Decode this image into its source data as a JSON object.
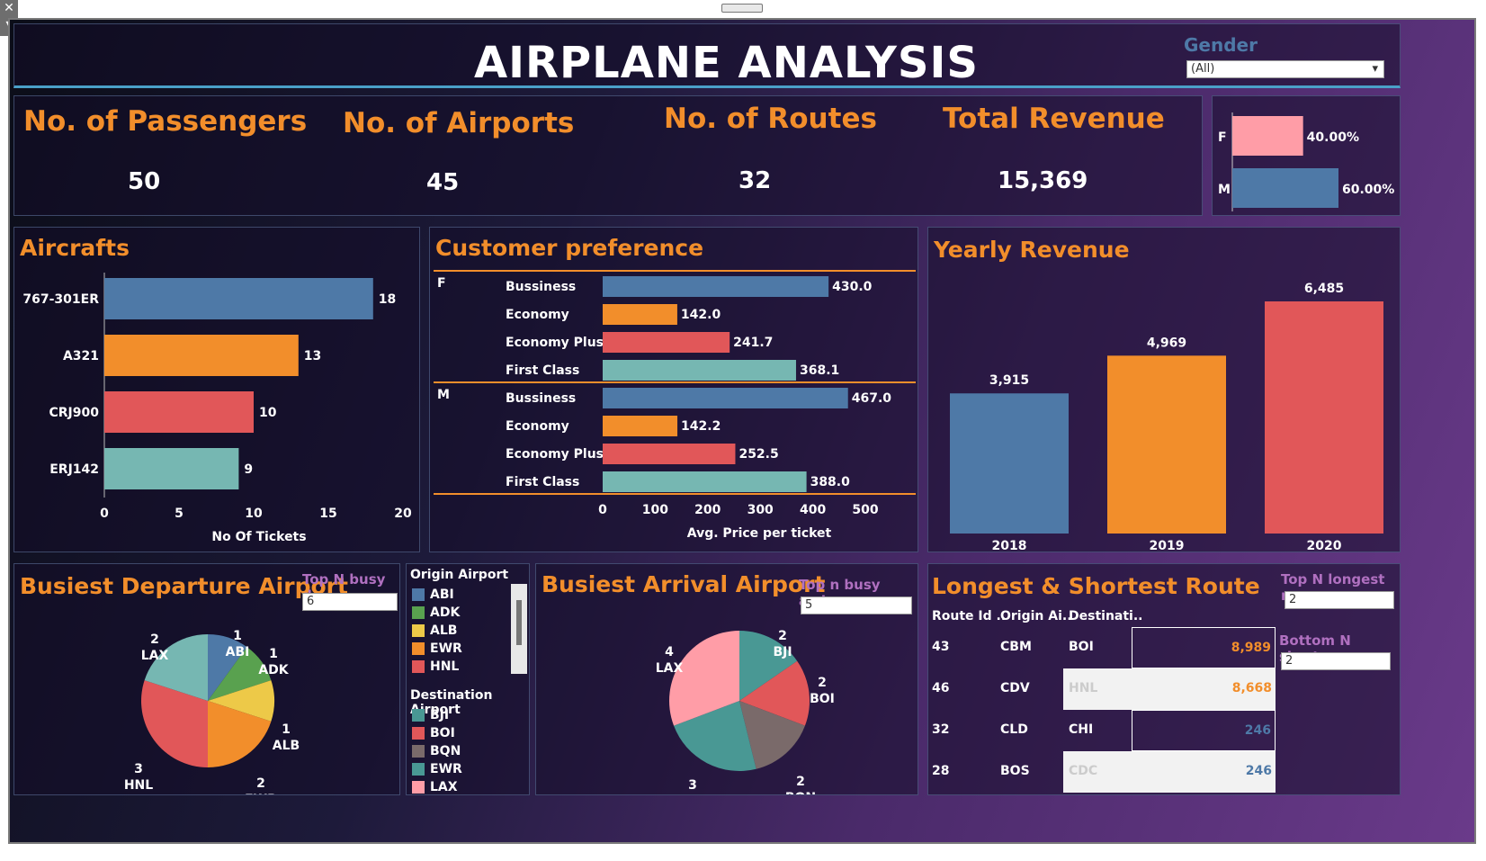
{
  "dashboard_title": "AIRPLANE ANALYSIS",
  "gender_filter": {
    "label": "Gender",
    "value": "(All)"
  },
  "kpis": [
    {
      "label": "No. of Passengers",
      "value": "50"
    },
    {
      "label": "No. of Airports",
      "value": "45"
    },
    {
      "label": "No. of Routes",
      "value": "32"
    },
    {
      "label": "Total Revenue",
      "value": "15,369"
    }
  ],
  "colors": {
    "blue": "#4e79a7",
    "orange": "#f28e2b",
    "red": "#e15759",
    "teal": "#76b7b2",
    "green": "#59a14f",
    "yellow": "#edc948",
    "pink": "#ff9da7",
    "brown": "#7a6a6a",
    "darkteal": "#499894"
  },
  "titles": {
    "aircrafts": "Aircrafts",
    "customer_pref": "Customer preference",
    "yearly_revenue": "Yearly Revenue",
    "busiest_departure": "Busiest Departure Airport",
    "busiest_arrival": "Busiest Arrival Airport",
    "longest_shortest": "Longest & Shortest Route"
  },
  "filters": {
    "top_n_departure": {
      "label": "Top N busy d..",
      "value": "6"
    },
    "top_n_arrival": {
      "label": "Top n busy arri..",
      "value": "5"
    },
    "top_n_longest": {
      "label": "Top N longest rou..",
      "value": "2"
    },
    "bottom_n_shortest": {
      "label": "Bottom N shortes..",
      "value": "2"
    }
  },
  "legends": {
    "origin_title": "Origin Airport",
    "origin_items": [
      "ABI",
      "ADK",
      "ALB",
      "EWR",
      "HNL"
    ],
    "destination_title": "Destination Airport",
    "destination_items": [
      "BJI",
      "BOI",
      "BQN",
      "EWR",
      "LAX"
    ]
  },
  "route_table": {
    "headers": [
      "Route Id ..",
      "Origin Ai..",
      "Destinati.."
    ],
    "rows": [
      {
        "route_id": "43",
        "origin": "CBM",
        "dest": "BOI",
        "value": "8,989"
      },
      {
        "route_id": "46",
        "origin": "CDV",
        "dest": "HNL",
        "value": "8,668"
      },
      {
        "route_id": "32",
        "origin": "CLD",
        "dest": "CHI",
        "value": "246"
      },
      {
        "route_id": "28",
        "origin": "BOS",
        "dest": "CDC",
        "value": "246"
      }
    ]
  },
  "chart_data": [
    {
      "id": "gender",
      "type": "bar",
      "orientation": "horizontal",
      "categories": [
        "F",
        "M"
      ],
      "values": [
        40.0,
        60.0
      ],
      "labels": [
        "40.00%",
        "60.00%"
      ]
    },
    {
      "id": "aircrafts",
      "type": "bar",
      "orientation": "horizontal",
      "title": "Aircrafts",
      "categories": [
        "767-301ER",
        "A321",
        "CRJ900",
        "ERJ142"
      ],
      "values": [
        18,
        13,
        10,
        9
      ],
      "xlabel": "No Of Tickets",
      "xlim": [
        0,
        20
      ],
      "ticks": [
        0,
        5,
        10,
        15,
        20
      ]
    },
    {
      "id": "customer_preference",
      "type": "bar",
      "orientation": "horizontal",
      "title": "Customer preference",
      "groups": [
        {
          "name": "F",
          "categories": [
            "Bussiness",
            "Economy",
            "Economy Plus",
            "First Class"
          ],
          "values": [
            430.0,
            142.0,
            241.7,
            368.1
          ]
        },
        {
          "name": "M",
          "categories": [
            "Bussiness",
            "Economy",
            "Economy Plus",
            "First Class"
          ],
          "values": [
            467.0,
            142.2,
            252.5,
            388.0
          ]
        }
      ],
      "xlabel": "Avg. Price per ticket",
      "xlim": [
        0,
        550
      ],
      "ticks": [
        0,
        100,
        200,
        300,
        400,
        500
      ]
    },
    {
      "id": "yearly_revenue",
      "type": "bar",
      "title": "Yearly Revenue",
      "categories": [
        "2018",
        "2019",
        "2020"
      ],
      "values": [
        3915,
        4969,
        6485
      ],
      "labels": [
        "3,915",
        "4,969",
        "6,485"
      ]
    },
    {
      "id": "busiest_departure",
      "type": "pie",
      "title": "Busiest Departure Airport",
      "categories": [
        "ABI",
        "ADK",
        "ALB",
        "EWR",
        "HNL",
        "LAX"
      ],
      "values": [
        1,
        1,
        1,
        2,
        3,
        2
      ]
    },
    {
      "id": "busiest_arrival",
      "type": "pie",
      "title": "Busiest Arrival Airport",
      "categories": [
        "BJI",
        "BOI",
        "BQN",
        "EWR",
        "LAX"
      ],
      "values": [
        2,
        2,
        2,
        3,
        4
      ]
    }
  ]
}
